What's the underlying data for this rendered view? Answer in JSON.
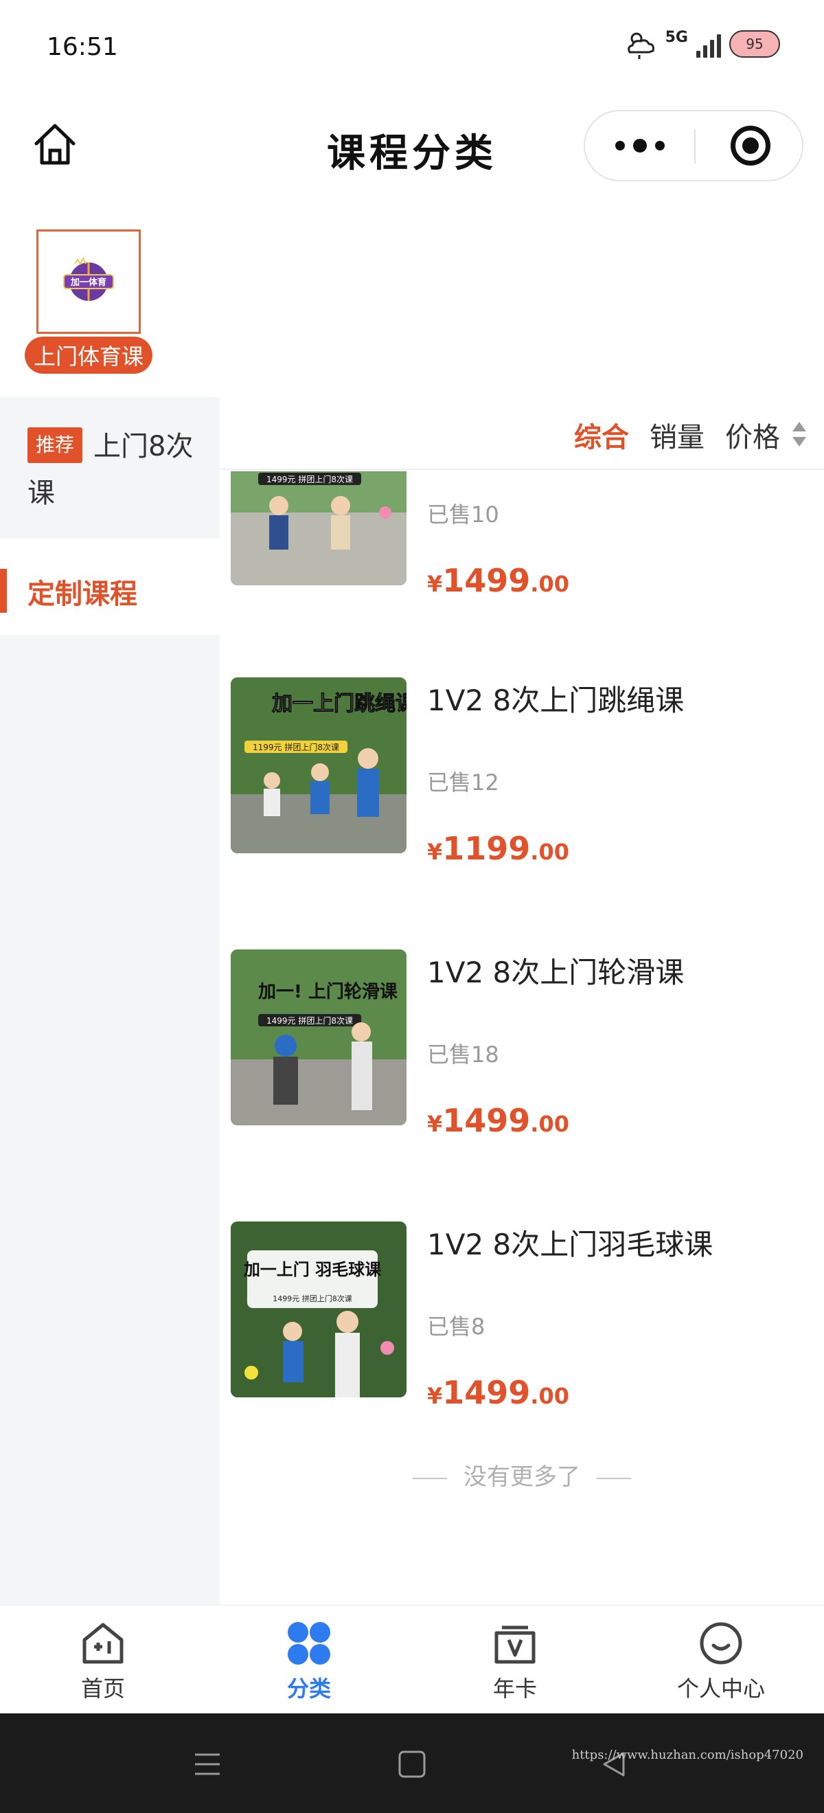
{
  "status_bar": {
    "time": "16:51",
    "network": "5G",
    "battery": "95"
  },
  "nav": {
    "title": "课程分类"
  },
  "top_category": {
    "logo_text": "加一体育",
    "label": "上门体育课"
  },
  "sidebar": {
    "items": [
      {
        "badge": "推荐",
        "label": "上门8次课"
      },
      {
        "label": "定制课程"
      }
    ]
  },
  "sort": {
    "items": [
      "综合",
      "销量",
      "价格"
    ]
  },
  "products": [
    {
      "name": "",
      "thumb_text": "1499元 拼团上门8次课",
      "sold": "已售10",
      "price_currency": "¥",
      "price_int": "1499",
      "price_dec": ".00"
    },
    {
      "name": "1V2 8次上门跳绳课",
      "thumb_title": "加一上门跳绳课",
      "thumb_text": "1199元 拼团上门8次课",
      "sold": "已售12",
      "price_currency": "¥",
      "price_int": "1199",
      "price_dec": ".00"
    },
    {
      "name": "1V2 8次上门轮滑课",
      "thumb_title": "加一! 上门轮滑课",
      "thumb_text": "1499元 拼团上门8次课",
      "sold": "已售18",
      "price_currency": "¥",
      "price_int": "1499",
      "price_dec": ".00"
    },
    {
      "name": "1V2 8次上门羽毛球课",
      "thumb_title": "加一上门 羽毛球课",
      "thumb_text": "1499元 拼团上门8次课",
      "sold": "已售8",
      "price_currency": "¥",
      "price_int": "1499",
      "price_dec": ".00"
    }
  ],
  "list_end": "没有更多了",
  "tab_bar": {
    "items": [
      {
        "label": "首页",
        "icon": "home-plus-icon"
      },
      {
        "label": "分类",
        "icon": "grid-icon"
      },
      {
        "label": "年卡",
        "icon": "vip-card-icon"
      },
      {
        "label": "个人中心",
        "icon": "smile-profile-icon"
      }
    ],
    "active": "分类"
  },
  "watermark": "https://www.huzhan.com/ishop47020",
  "colors": {
    "accent": "#e2522a",
    "tab_active": "#2d7bef",
    "sidebar_bg": "#f4f5f7"
  }
}
